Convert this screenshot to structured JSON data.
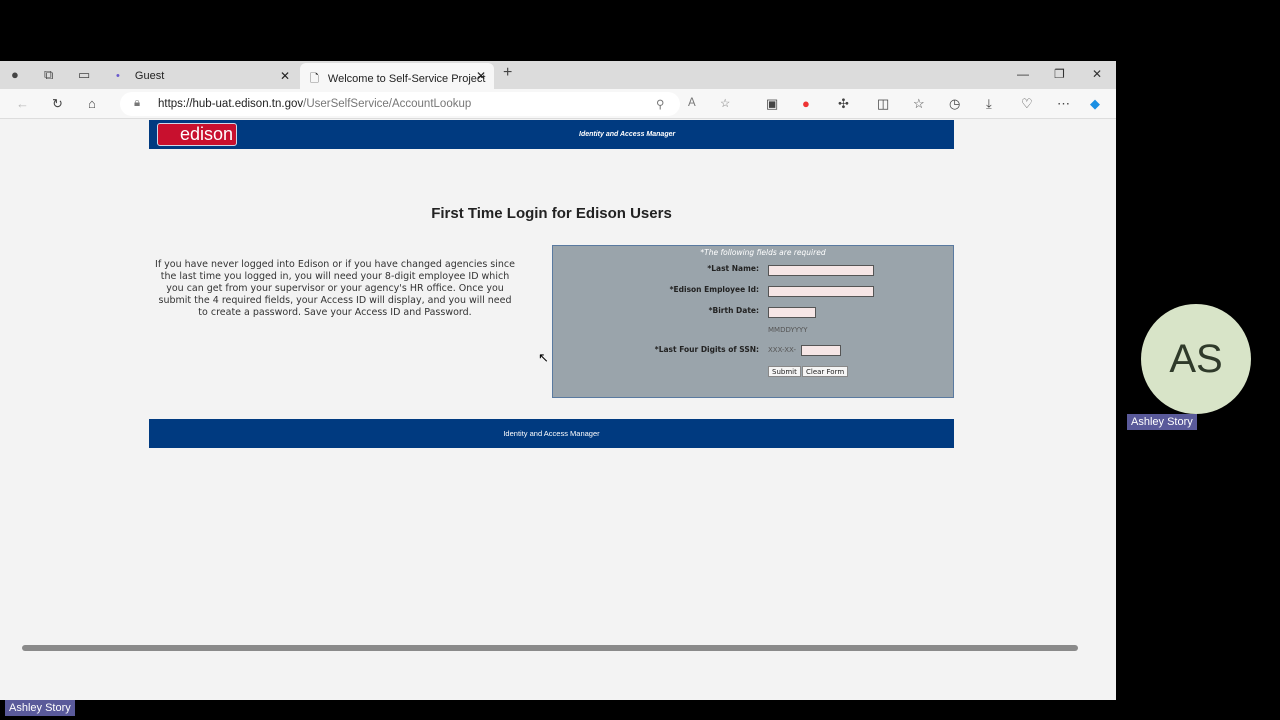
{
  "browser": {
    "tabs": [
      {
        "label": "Guest"
      },
      {
        "label": "Welcome to Self-Service Project"
      }
    ],
    "url_host": "https://hub-uat.edison.tn.gov",
    "url_path": "/UserSelfService/AccountLookup"
  },
  "page": {
    "logo": "edison",
    "header_title": "Identity and Access Manager",
    "title": "First Time Login for Edison Users",
    "intro": "If you have never logged into Edison or if you have changed agencies since the last time you logged in, you will need your 8-digit employee ID which you can get from your supervisor or your agency's HR office. Once you submit the 4 required fields, your Access ID will display, and you will need to create a password. Save your Access ID and Password.",
    "form": {
      "required_note": "*The following fields are required",
      "last_name": "*Last Name:",
      "employee_id": "*Edison Employee Id:",
      "birth_date": "*Birth Date:",
      "date_hint": "MMDDYYYY",
      "ssn": "*Last Four Digits of SSN:",
      "ssn_prefix": "XXX-XX-",
      "submit": "Submit",
      "clear": "Clear Form"
    },
    "footer": "Identity and Access Manager"
  },
  "meeting": {
    "avatar_initials": "AS",
    "participant": "Ashley Story",
    "self": "Ashley Story"
  }
}
